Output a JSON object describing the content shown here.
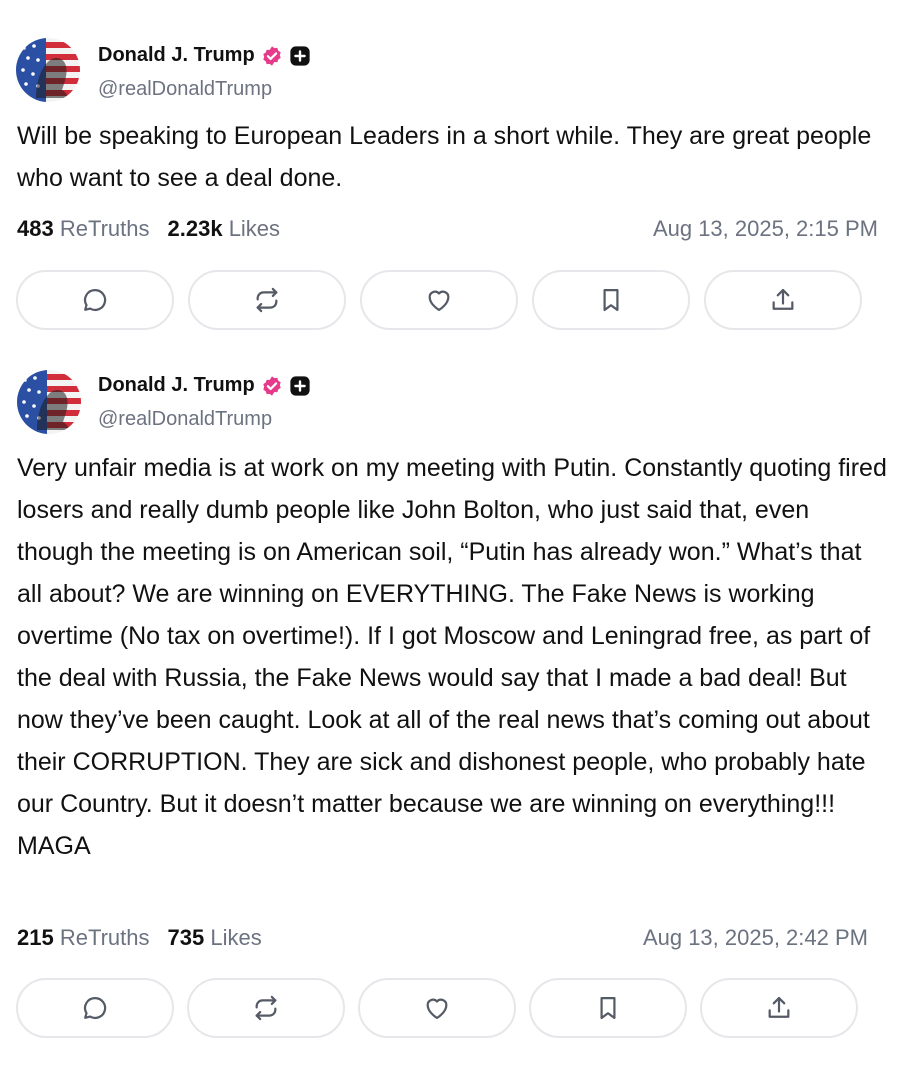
{
  "colors": {
    "verified_badge": "#e63a8a",
    "plus_badge": "#111111",
    "muted_text": "#6b7280",
    "button_border": "#e6e7ea"
  },
  "posts": [
    {
      "author_name": "Donald J. Trump",
      "handle": "@realDonaldTrump",
      "text": "Will be speaking to European Leaders in a short while. They are great people who want to see a deal done.",
      "retruths_count": "483",
      "retruths_label": "ReTruths",
      "likes_count": "2.23k",
      "likes_label": "Likes",
      "timestamp": "Aug 13, 2025, 2:15 PM",
      "actions": [
        "reply-icon",
        "retruth-icon",
        "like-icon",
        "bookmark-icon",
        "share-icon"
      ]
    },
    {
      "author_name": "Donald J. Trump",
      "handle": "@realDonaldTrump",
      "text": "Very unfair media is at work on my meeting with Putin. Constantly quoting fired losers and really dumb people like John Bolton, who just said that, even though the meeting is on American soil, “Putin has already won.” What’s that all about? We are winning on EVERYTHING. The Fake News is working overtime (No tax on overtime!). If I got Moscow and Leningrad free, as part of the deal with Russia, the Fake News would say that I made a bad deal! But now they’ve been caught. Look at all of the real news that’s coming out about their CORRUPTION. They are sick and dishonest people, who probably hate our Country. But it doesn’t matter because we are winning on everything!!! MAGA",
      "retruths_count": "215",
      "retruths_label": "ReTruths",
      "likes_count": "735",
      "likes_label": "Likes",
      "timestamp": "Aug 13, 2025, 2:42 PM",
      "actions": [
        "reply-icon",
        "retruth-icon",
        "like-icon",
        "bookmark-icon",
        "share-icon"
      ]
    }
  ]
}
